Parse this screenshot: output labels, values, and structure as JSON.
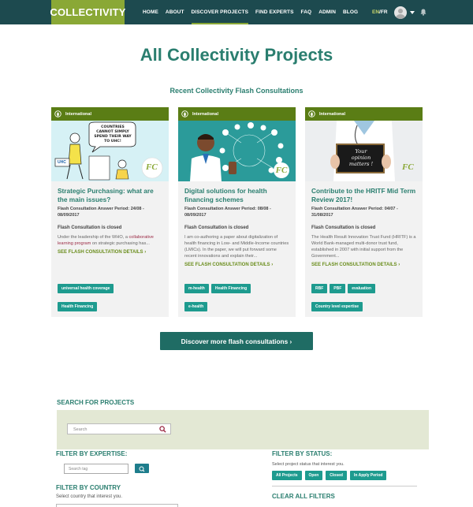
{
  "header": {
    "logo": "COLLECTIVITY",
    "nav": [
      {
        "label": "HOME"
      },
      {
        "label": "ABOUT"
      },
      {
        "label": "DISCOVER PROJECTS",
        "active": true
      },
      {
        "label": "FIND EXPERTS"
      },
      {
        "label": "FAQ"
      },
      {
        "label": "ADMIN"
      },
      {
        "label": "BLOG"
      }
    ],
    "lang_en": "EN",
    "lang_sep": "/",
    "lang_fr": "FR"
  },
  "page_title": "All Collectivity Projects",
  "subtitle": "Recent Collectivity Flash Consultations",
  "cards": [
    {
      "region": "International",
      "image_icon": "uhc-cartoon-image",
      "title": "Strategic Purchasing: what are the main issues?",
      "period": "Flash Consultation Answer Period: 24/08 - 08/09/2017",
      "status": "Flash Consultation is closed",
      "desc_pre": "Under the leadership of the WHO, a ",
      "desc_link": "collaborative learning program",
      "desc_post": " on strategic purchasing has...",
      "details": "SEE FLASH CONSULTATION DETAILS",
      "tags": [
        "universal health coverage",
        "Health Financing"
      ]
    },
    {
      "region": "International",
      "image_icon": "digital-doctor-image",
      "title": "Digital solutions for health financing schemes",
      "period": "Flash Consultation Answer Period: 08/08 - 08/09/2017",
      "status": "Flash Consultation is closed",
      "desc_pre": "I am co-authoring a paper about digitalization of health financing in Low- and Middle-Income countries (LMICs). In the paper, we will put forward some recent innovations and explain their...",
      "desc_link": "",
      "desc_post": "",
      "details": "SEE FLASH CONSULTATION DETAILS",
      "tags": [
        "m-health",
        "Health Financing",
        "e-health"
      ]
    },
    {
      "region": "International",
      "image_icon": "doctor-sign-image",
      "image_sign_1": "Your",
      "image_sign_2": "opinion",
      "image_sign_3": "matters !",
      "title": "Contribute to the HRITF Mid Term Review 2017!",
      "period": "Flash Consultation Answer Period: 04/07 - 31/08/2017",
      "status": "Flash Consultation is closed",
      "desc_pre": "The Health Result Innovation Trust Fund (HRITF) is a World Bank-managed multi-donor trust fund, established in 2007 with initial support from the Government...",
      "desc_link": "",
      "desc_post": "",
      "details": "SEE FLASH CONSULTATION DETAILS",
      "tags": [
        "RBF",
        "PBF",
        "evaluation",
        "Country level expertise"
      ]
    }
  ],
  "cartoon_bubble": "COUNTRIES CANNOT SIMPLY SPEND THEIR WAY TO UHC!",
  "cartoon_sign": "UHC",
  "fc_badge": "FC",
  "more_button": "Discover more flash consultations",
  "search": {
    "title": "SEARCH FOR PROJECTS",
    "placeholder": "Search"
  },
  "filters": {
    "expertise_title": "FILTER BY EXPERTISE:",
    "tag_placeholder": "Search tag",
    "country_title": "FILTER BY COUNTRY",
    "country_hint": "Select country that interest you.",
    "status_title": "FILTER BY STATUS:",
    "status_hint": "Select project status that interest you.",
    "status_options": [
      "All Projects",
      "Open",
      "Closed",
      "In Apply Period"
    ],
    "clear": "CLEAR ALL FILTERS"
  },
  "colors": {
    "header_bg": "#1d4a4f",
    "logo_bg": "#8aa836",
    "title_teal": "#2a7e6f",
    "card_head": "#5a7d15",
    "tag_teal": "#1e9b8f",
    "button_dark": "#1f6c64"
  }
}
